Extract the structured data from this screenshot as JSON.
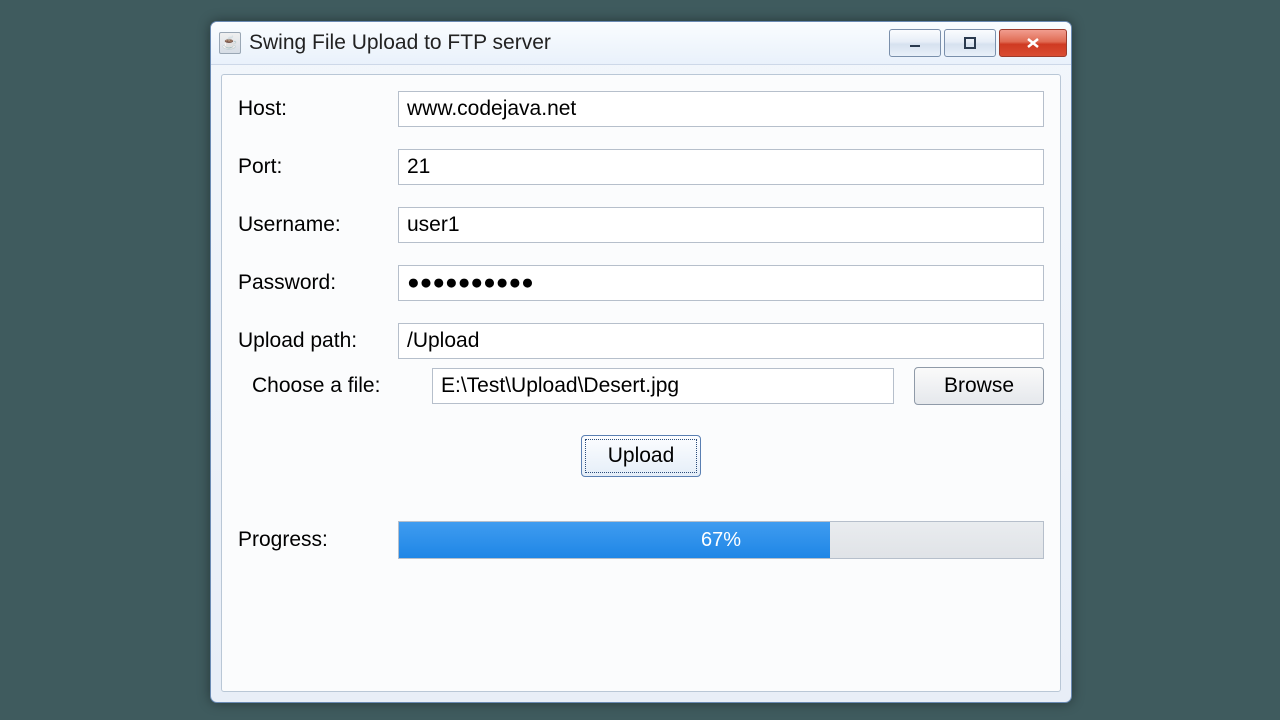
{
  "window": {
    "title": "Swing File Upload to FTP server"
  },
  "labels": {
    "host": "Host:",
    "port": "Port:",
    "username": "Username:",
    "password": "Password:",
    "upload_path": "Upload path:",
    "choose_file": "Choose a file:",
    "progress": "Progress:"
  },
  "fields": {
    "host": "www.codejava.net",
    "port": "21",
    "username": "user1",
    "password": "●●●●●●●●●●",
    "upload_path": "/Upload",
    "file_path": "E:\\Test\\Upload\\Desert.jpg"
  },
  "buttons": {
    "browse": "Browse",
    "upload": "Upload"
  },
  "progress": {
    "percent": 67,
    "text": "67%"
  }
}
